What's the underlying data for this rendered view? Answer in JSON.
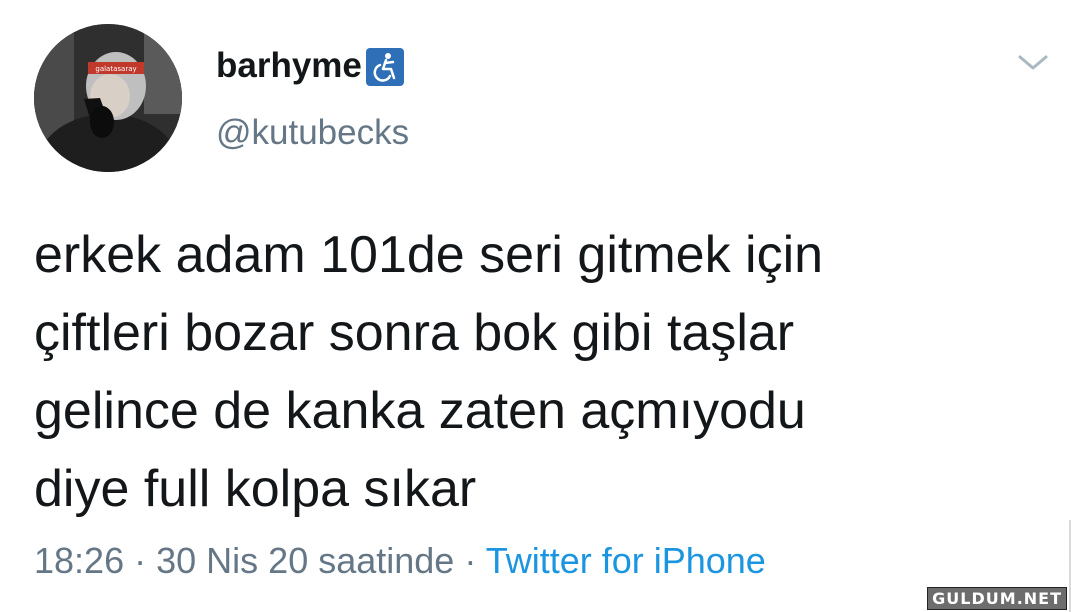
{
  "user": {
    "display_name": "barhyme",
    "handle": "@kutubecks",
    "avatar_badge_text": "galatasaray"
  },
  "tweet": {
    "lines": [
      "erkek adam 101de seri gitmek için",
      "çiftleri bozar sonra bok gibi taşlar",
      "gelince de kanka zaten açmıyodu",
      "diye full kolpa sıkar"
    ]
  },
  "meta": {
    "time": "18:26",
    "separator": "·",
    "date": "30 Nis 20 saatinde",
    "source": "Twitter for iPhone"
  },
  "watermark": "GULDUM.NET",
  "icons": {
    "accessibility": "wheelchair-accessibility-icon",
    "menu": "chevron-down-icon"
  },
  "colors": {
    "text": "#14171a",
    "secondary": "#657786",
    "link": "#1b95e0",
    "badge": "#2e6fb8"
  }
}
